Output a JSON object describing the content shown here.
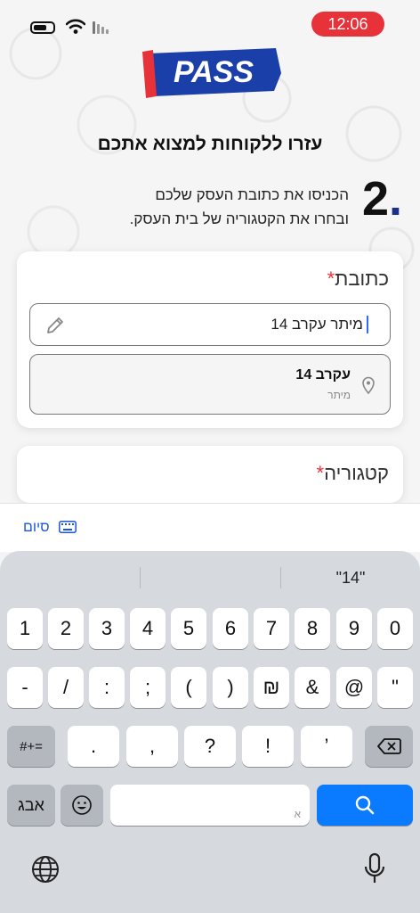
{
  "status": {
    "time": "12:06"
  },
  "brand": {
    "logo_text": "PASS"
  },
  "headline": "עזרו ללקוחות למצוא אתכם",
  "step": {
    "number": "2",
    "line1": "הכניסו את כתובת העסק שלכם",
    "line2": "ובחרו את הקטגוריה של בית העסק."
  },
  "address": {
    "label": "כתובת",
    "required": "*",
    "input_value": "מיתר עקרב 14",
    "suggestion_main": "עקרב 14",
    "suggestion_sub": "מיתר"
  },
  "category": {
    "label": "קטגוריה",
    "required": "*"
  },
  "accessory": {
    "done_label": "סיום"
  },
  "keyboard": {
    "suggestion": "\"14\"",
    "row1": [
      "1",
      "2",
      "3",
      "4",
      "5",
      "6",
      "7",
      "8",
      "9",
      "0"
    ],
    "row2": [
      "-",
      "/",
      ":",
      ";",
      "(",
      ")",
      "₪",
      "&",
      "@",
      "\""
    ],
    "row3": [
      ".",
      ",",
      "?",
      "!",
      "’"
    ],
    "mode_key": "#+=",
    "lang_key": "אבג",
    "space_hint": "א"
  },
  "colors": {
    "accent_red": "#e8323a",
    "keyboard_action": "#0a7aff",
    "brand_blue": "#1a2f8a"
  }
}
